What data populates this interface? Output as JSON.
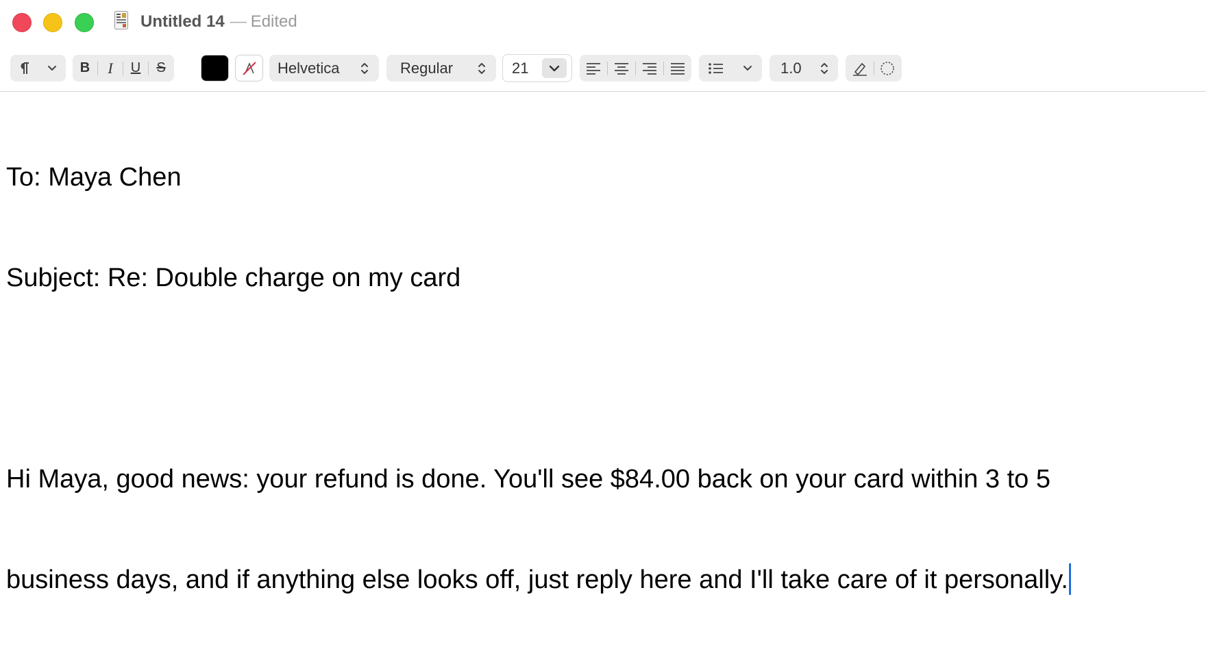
{
  "window": {
    "title": "Untitled 14",
    "separator": "—",
    "status": "Edited"
  },
  "toolbar": {
    "paragraph_style_icon": "paragraph-icon",
    "bold_label": "B",
    "italic_label": "I",
    "underline_label": "U",
    "strikethrough_label": "S",
    "text_color": "#000000",
    "font_family": "Helvetica",
    "font_style": "Regular",
    "font_size": "21",
    "line_spacing": "1.0"
  },
  "document": {
    "lines": [
      "To: Maya Chen",
      "Subject: Re: Double charge on my card",
      "",
      "Hi Maya, good news: your refund is done. You'll see $84.00 back on your card within 3 to 5",
      "business days, and if anything else looks off, just reply here and I'll take care of it personally."
    ]
  },
  "colors": {
    "caret": "#1f6fe0",
    "close": "#f0485a",
    "minimize": "#f6c419",
    "maximize": "#3acf55"
  }
}
